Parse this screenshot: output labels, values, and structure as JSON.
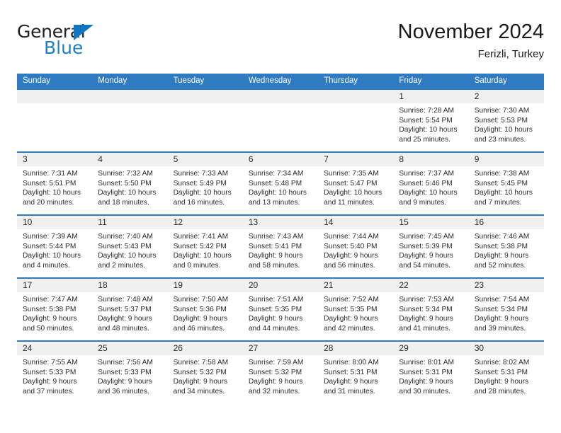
{
  "brand": {
    "name_part1": "General",
    "name_part2": "Blue",
    "triangle_icon": "blue-triangle-icon",
    "accent_color": "#1f7fc4"
  },
  "header": {
    "title": "November 2024",
    "subtitle": "Ferizli, Turkey"
  },
  "theme": {
    "header_bg": "#2f7ac0",
    "daynum_bg": "#f0f0f0",
    "text": "#2b2b2b"
  },
  "calendar": {
    "weekday_headers": [
      "Sunday",
      "Monday",
      "Tuesday",
      "Wednesday",
      "Thursday",
      "Friday",
      "Saturday"
    ],
    "weeks": [
      [
        {
          "day": "",
          "empty": true
        },
        {
          "day": "",
          "empty": true
        },
        {
          "day": "",
          "empty": true
        },
        {
          "day": "",
          "empty": true
        },
        {
          "day": "",
          "empty": true
        },
        {
          "day": "1",
          "sunrise": "Sunrise: 7:28 AM",
          "sunset": "Sunset: 5:54 PM",
          "daylight1": "Daylight: 10 hours",
          "daylight2": "and 25 minutes."
        },
        {
          "day": "2",
          "sunrise": "Sunrise: 7:30 AM",
          "sunset": "Sunset: 5:53 PM",
          "daylight1": "Daylight: 10 hours",
          "daylight2": "and 23 minutes."
        }
      ],
      [
        {
          "day": "3",
          "sunrise": "Sunrise: 7:31 AM",
          "sunset": "Sunset: 5:51 PM",
          "daylight1": "Daylight: 10 hours",
          "daylight2": "and 20 minutes."
        },
        {
          "day": "4",
          "sunrise": "Sunrise: 7:32 AM",
          "sunset": "Sunset: 5:50 PM",
          "daylight1": "Daylight: 10 hours",
          "daylight2": "and 18 minutes."
        },
        {
          "day": "5",
          "sunrise": "Sunrise: 7:33 AM",
          "sunset": "Sunset: 5:49 PM",
          "daylight1": "Daylight: 10 hours",
          "daylight2": "and 16 minutes."
        },
        {
          "day": "6",
          "sunrise": "Sunrise: 7:34 AM",
          "sunset": "Sunset: 5:48 PM",
          "daylight1": "Daylight: 10 hours",
          "daylight2": "and 13 minutes."
        },
        {
          "day": "7",
          "sunrise": "Sunrise: 7:35 AM",
          "sunset": "Sunset: 5:47 PM",
          "daylight1": "Daylight: 10 hours",
          "daylight2": "and 11 minutes."
        },
        {
          "day": "8",
          "sunrise": "Sunrise: 7:37 AM",
          "sunset": "Sunset: 5:46 PM",
          "daylight1": "Daylight: 10 hours",
          "daylight2": "and 9 minutes."
        },
        {
          "day": "9",
          "sunrise": "Sunrise: 7:38 AM",
          "sunset": "Sunset: 5:45 PM",
          "daylight1": "Daylight: 10 hours",
          "daylight2": "and 7 minutes."
        }
      ],
      [
        {
          "day": "10",
          "sunrise": "Sunrise: 7:39 AM",
          "sunset": "Sunset: 5:44 PM",
          "daylight1": "Daylight: 10 hours",
          "daylight2": "and 4 minutes."
        },
        {
          "day": "11",
          "sunrise": "Sunrise: 7:40 AM",
          "sunset": "Sunset: 5:43 PM",
          "daylight1": "Daylight: 10 hours",
          "daylight2": "and 2 minutes."
        },
        {
          "day": "12",
          "sunrise": "Sunrise: 7:41 AM",
          "sunset": "Sunset: 5:42 PM",
          "daylight1": "Daylight: 10 hours",
          "daylight2": "and 0 minutes."
        },
        {
          "day": "13",
          "sunrise": "Sunrise: 7:43 AM",
          "sunset": "Sunset: 5:41 PM",
          "daylight1": "Daylight: 9 hours",
          "daylight2": "and 58 minutes."
        },
        {
          "day": "14",
          "sunrise": "Sunrise: 7:44 AM",
          "sunset": "Sunset: 5:40 PM",
          "daylight1": "Daylight: 9 hours",
          "daylight2": "and 56 minutes."
        },
        {
          "day": "15",
          "sunrise": "Sunrise: 7:45 AM",
          "sunset": "Sunset: 5:39 PM",
          "daylight1": "Daylight: 9 hours",
          "daylight2": "and 54 minutes."
        },
        {
          "day": "16",
          "sunrise": "Sunrise: 7:46 AM",
          "sunset": "Sunset: 5:38 PM",
          "daylight1": "Daylight: 9 hours",
          "daylight2": "and 52 minutes."
        }
      ],
      [
        {
          "day": "17",
          "sunrise": "Sunrise: 7:47 AM",
          "sunset": "Sunset: 5:38 PM",
          "daylight1": "Daylight: 9 hours",
          "daylight2": "and 50 minutes."
        },
        {
          "day": "18",
          "sunrise": "Sunrise: 7:48 AM",
          "sunset": "Sunset: 5:37 PM",
          "daylight1": "Daylight: 9 hours",
          "daylight2": "and 48 minutes."
        },
        {
          "day": "19",
          "sunrise": "Sunrise: 7:50 AM",
          "sunset": "Sunset: 5:36 PM",
          "daylight1": "Daylight: 9 hours",
          "daylight2": "and 46 minutes."
        },
        {
          "day": "20",
          "sunrise": "Sunrise: 7:51 AM",
          "sunset": "Sunset: 5:35 PM",
          "daylight1": "Daylight: 9 hours",
          "daylight2": "and 44 minutes."
        },
        {
          "day": "21",
          "sunrise": "Sunrise: 7:52 AM",
          "sunset": "Sunset: 5:35 PM",
          "daylight1": "Daylight: 9 hours",
          "daylight2": "and 42 minutes."
        },
        {
          "day": "22",
          "sunrise": "Sunrise: 7:53 AM",
          "sunset": "Sunset: 5:34 PM",
          "daylight1": "Daylight: 9 hours",
          "daylight2": "and 41 minutes."
        },
        {
          "day": "23",
          "sunrise": "Sunrise: 7:54 AM",
          "sunset": "Sunset: 5:34 PM",
          "daylight1": "Daylight: 9 hours",
          "daylight2": "and 39 minutes."
        }
      ],
      [
        {
          "day": "24",
          "sunrise": "Sunrise: 7:55 AM",
          "sunset": "Sunset: 5:33 PM",
          "daylight1": "Daylight: 9 hours",
          "daylight2": "and 37 minutes."
        },
        {
          "day": "25",
          "sunrise": "Sunrise: 7:56 AM",
          "sunset": "Sunset: 5:33 PM",
          "daylight1": "Daylight: 9 hours",
          "daylight2": "and 36 minutes."
        },
        {
          "day": "26",
          "sunrise": "Sunrise: 7:58 AM",
          "sunset": "Sunset: 5:32 PM",
          "daylight1": "Daylight: 9 hours",
          "daylight2": "and 34 minutes."
        },
        {
          "day": "27",
          "sunrise": "Sunrise: 7:59 AM",
          "sunset": "Sunset: 5:32 PM",
          "daylight1": "Daylight: 9 hours",
          "daylight2": "and 32 minutes."
        },
        {
          "day": "28",
          "sunrise": "Sunrise: 8:00 AM",
          "sunset": "Sunset: 5:31 PM",
          "daylight1": "Daylight: 9 hours",
          "daylight2": "and 31 minutes."
        },
        {
          "day": "29",
          "sunrise": "Sunrise: 8:01 AM",
          "sunset": "Sunset: 5:31 PM",
          "daylight1": "Daylight: 9 hours",
          "daylight2": "and 30 minutes."
        },
        {
          "day": "30",
          "sunrise": "Sunrise: 8:02 AM",
          "sunset": "Sunset: 5:31 PM",
          "daylight1": "Daylight: 9 hours",
          "daylight2": "and 28 minutes."
        }
      ]
    ]
  }
}
